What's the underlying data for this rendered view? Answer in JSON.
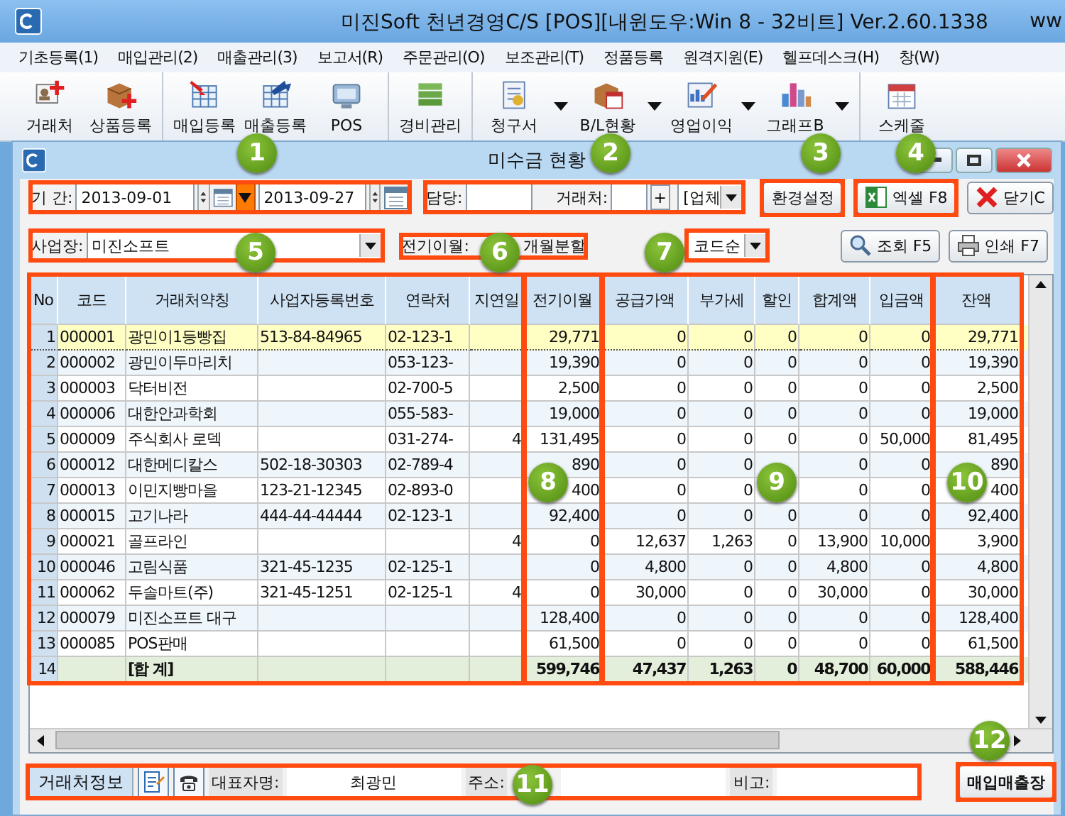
{
  "window": {
    "title": "미진Soft 천년경영C/S [POS][내윈도우:Win 8 - 32비트] Ver.2.60.1338",
    "title_cut": "ww"
  },
  "menu": [
    "기초등록(1)",
    "매입관리(2)",
    "매출관리(3)",
    "보고서(R)",
    "주문관리(O)",
    "보조관리(T)",
    "정품등록",
    "원격지원(E)",
    "헬프데스크(H)",
    "창(W)"
  ],
  "toolbar": [
    {
      "items": [
        {
          "label": "거래처",
          "dropdown": false
        },
        {
          "label": "상품등록",
          "dropdown": false
        }
      ]
    },
    {
      "items": [
        {
          "label": "매입등록",
          "dropdown": false
        },
        {
          "label": "매출등록",
          "dropdown": false
        },
        {
          "label": "POS",
          "dropdown": false
        }
      ]
    },
    {
      "items": [
        {
          "label": "경비관리",
          "dropdown": false
        }
      ]
    },
    {
      "items": [
        {
          "label": "청구서",
          "dropdown": true
        },
        {
          "label": "B/L현황",
          "dropdown": true
        },
        {
          "label": "영업이익",
          "dropdown": true
        },
        {
          "label": "그래프B",
          "dropdown": true
        }
      ]
    },
    {
      "items": [
        {
          "label": "스케줄",
          "dropdown": false
        }
      ]
    }
  ],
  "child_window": {
    "title": "미수금 현황"
  },
  "period": {
    "label": "기 간:",
    "from": "2013-09-01",
    "to": "2013-09-27"
  },
  "manager": {
    "label": "담당:"
  },
  "client": {
    "label": "거래처:",
    "add": "+",
    "type": "[업체"
  },
  "settings_button": "환경설정",
  "excel_button": "엑셀 F8",
  "close_button": "닫기C",
  "branch": {
    "label": "사업장:",
    "value": "미진소프트"
  },
  "carryover": {
    "label": "전기이월:",
    "option": "개월분할"
  },
  "sort": {
    "value": "코드순"
  },
  "search_button": "조회 F5",
  "print_button": "인쇄 F7",
  "table": {
    "columns": [
      "No",
      "코드",
      "거래처약칭",
      "사업자등록번호",
      "연락처",
      "지연일",
      "전기이월",
      "공급가액",
      "부가세",
      "할인",
      "합계액",
      "입금액",
      "잔액"
    ],
    "rows": [
      {
        "kind": "data",
        "selected": true,
        "cells": [
          "1",
          "000001",
          "광민이1등빵집",
          "513-84-84965",
          "02-123-1",
          null,
          "29,771",
          "0",
          "0",
          "0",
          "0",
          "0",
          "29,771"
        ]
      },
      {
        "kind": "data",
        "selected": false,
        "cells": [
          "2",
          "000002",
          "광민이두마리치",
          null,
          "053-123-",
          null,
          "19,390",
          "0",
          "0",
          "0",
          "0",
          "0",
          "19,390"
        ]
      },
      {
        "kind": "data",
        "selected": false,
        "cells": [
          "3",
          "000003",
          "닥터비전",
          null,
          "02-700-5",
          null,
          "2,500",
          "0",
          "0",
          "0",
          "0",
          "0",
          "2,500"
        ]
      },
      {
        "kind": "data",
        "selected": false,
        "cells": [
          "4",
          "000006",
          "대한안과학회",
          null,
          "055-583-",
          null,
          "19,000",
          "0",
          "0",
          "0",
          "0",
          "0",
          "19,000"
        ]
      },
      {
        "kind": "data",
        "selected": false,
        "cells": [
          "5",
          "000009",
          "주식회사 로덱",
          null,
          "031-274-",
          "4",
          "131,495",
          "0",
          "0",
          "0",
          "0",
          "50,000",
          "81,495"
        ]
      },
      {
        "kind": "data",
        "selected": false,
        "cells": [
          "6",
          "000012",
          "대한메디칼스",
          "502-18-30303",
          "02-789-4",
          null,
          "890",
          "0",
          "0",
          null,
          "0",
          "0",
          "890"
        ]
      },
      {
        "kind": "data",
        "selected": false,
        "cells": [
          "7",
          "000013",
          "이민지빵마을",
          "123-21-12345",
          "02-893-0",
          null,
          "400",
          "0",
          "0",
          null,
          "0",
          "0",
          "400"
        ]
      },
      {
        "kind": "data",
        "selected": false,
        "cells": [
          "8",
          "000015",
          "고기나라",
          "444-44-44444",
          "02-123-1",
          null,
          "92,400",
          "0",
          "0",
          "0",
          "0",
          "0",
          "92,400"
        ]
      },
      {
        "kind": "data",
        "selected": false,
        "cells": [
          "9",
          "000021",
          "골프라인",
          null,
          null,
          "4",
          "0",
          "12,637",
          "1,263",
          "0",
          "13,900",
          "10,000",
          "3,900"
        ]
      },
      {
        "kind": "data",
        "selected": false,
        "cells": [
          "10",
          "000046",
          "고림식품",
          "321-45-1235",
          "02-125-1",
          null,
          "0",
          "4,800",
          "0",
          "0",
          "4,800",
          "0",
          "4,800"
        ]
      },
      {
        "kind": "data",
        "selected": false,
        "cells": [
          "11",
          "000062",
          "두솔마트(주)",
          "321-45-1251",
          "02-125-1",
          "4",
          "0",
          "30,000",
          "0",
          "0",
          "30,000",
          "0",
          "30,000"
        ]
      },
      {
        "kind": "data",
        "selected": false,
        "cells": [
          "12",
          "000079",
          "미진소프트 대구",
          null,
          null,
          null,
          "128,400",
          "0",
          "0",
          "0",
          "0",
          "0",
          "128,400"
        ]
      },
      {
        "kind": "data",
        "selected": false,
        "cells": [
          "13",
          "000085",
          "POS판매",
          null,
          null,
          null,
          "61,500",
          "0",
          "0",
          "0",
          "0",
          "0",
          "61,500"
        ]
      },
      {
        "kind": "total",
        "selected": false,
        "cells": [
          "14",
          null,
          "[합 계]",
          null,
          null,
          null,
          "599,746",
          "47,437",
          "1,263",
          "0",
          "48,700",
          "60,000",
          "588,446"
        ]
      }
    ]
  },
  "footer": {
    "tab": "거래처정보",
    "owner_label": "대표자명:",
    "owner": "최광민",
    "address_label": "주소:",
    "note_label": "비고:",
    "ledger_button": "매입매출장"
  },
  "callouts": [
    "1",
    "2",
    "3",
    "4",
    "5",
    "6",
    "7",
    "8",
    "9",
    "10",
    "11",
    "12"
  ]
}
